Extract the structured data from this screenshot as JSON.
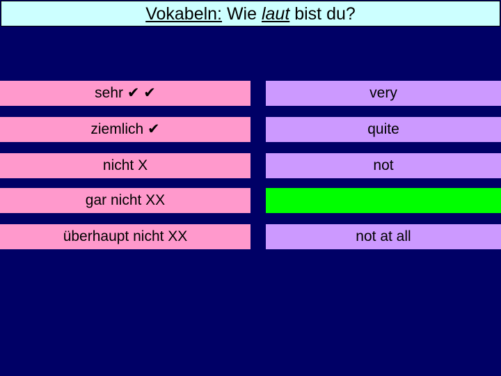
{
  "title": {
    "part1": "Vokabeln:",
    "part2": " Wie ",
    "part3": "laut",
    "part4": " bist du?"
  },
  "rows": [
    {
      "german": "sehr ✔ ✔",
      "english": "very"
    },
    {
      "german": "ziemlich ✔",
      "english": "quite"
    },
    {
      "german": "nicht X",
      "english": "not"
    },
    {
      "german": "gar nicht XX",
      "english": ""
    },
    {
      "german": "überhaupt nicht XX",
      "english": "not at all"
    }
  ],
  "colors": {
    "background": "#000066",
    "title_bg": "#ccffff",
    "german_bg": "#ff99cc",
    "english_bg": "#cc99ff",
    "highlight_bg": "#00ff00"
  }
}
